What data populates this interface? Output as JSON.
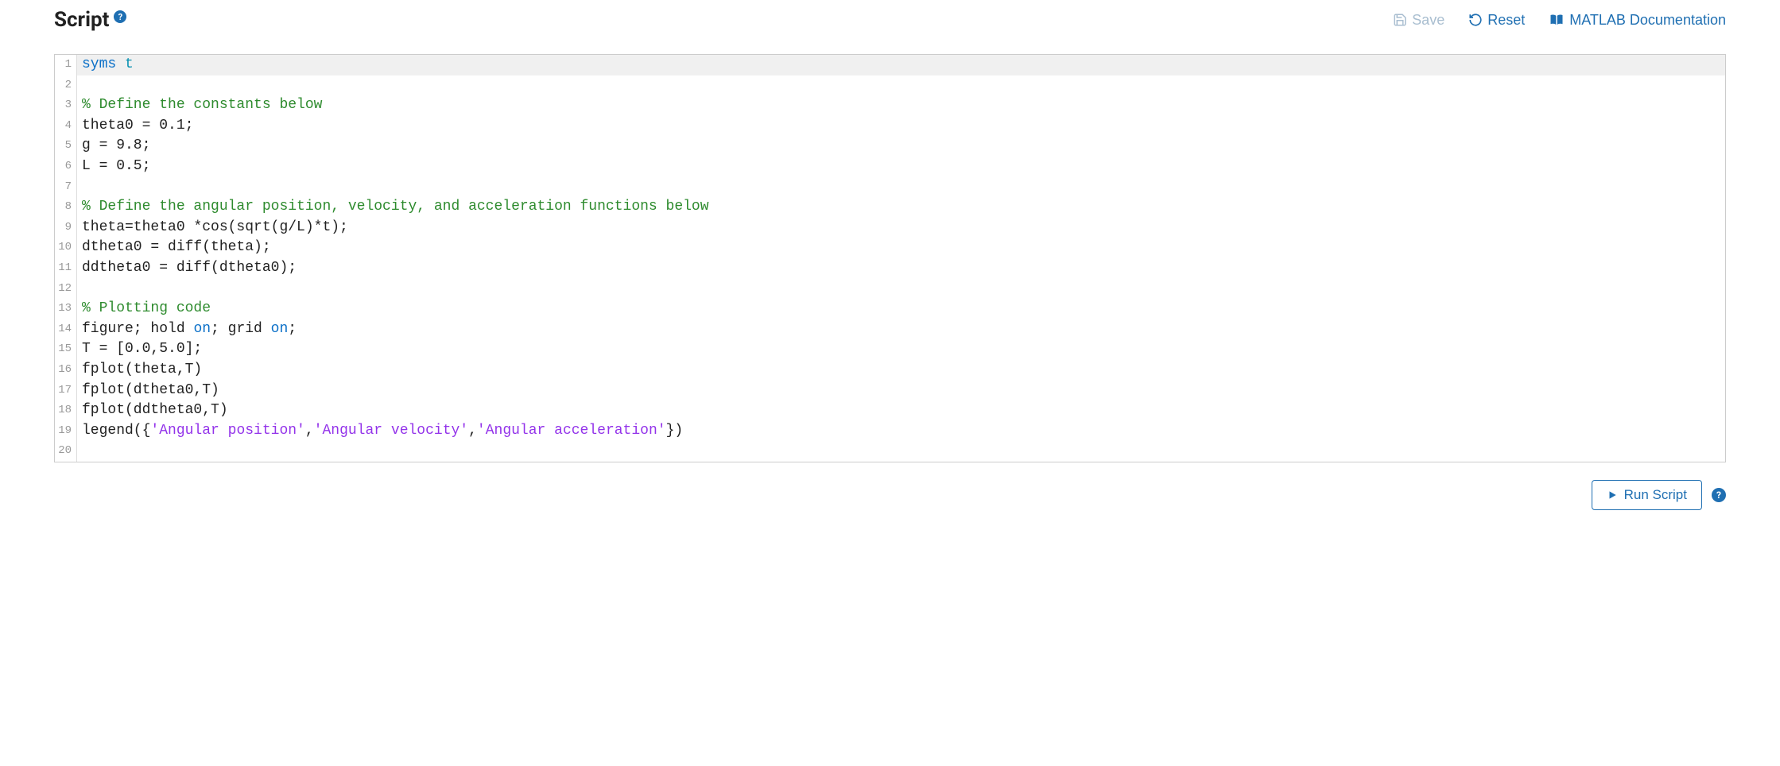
{
  "header": {
    "title": "Script",
    "help_glyph": "?"
  },
  "toolbar": {
    "save_label": "Save",
    "reset_label": "Reset",
    "docs_label": "MATLAB Documentation"
  },
  "editor": {
    "lines": [
      {
        "n": 1,
        "active": true,
        "tokens": [
          {
            "t": "syms ",
            "c": "keyword"
          },
          {
            "t": "t",
            "c": "ident"
          }
        ]
      },
      {
        "n": 2,
        "tokens": [
          {
            "t": "",
            "c": ""
          }
        ]
      },
      {
        "n": 3,
        "tokens": [
          {
            "t": "% Define the constants below",
            "c": "comment"
          }
        ]
      },
      {
        "n": 4,
        "tokens": [
          {
            "t": "theta0 = 0.1;",
            "c": ""
          }
        ]
      },
      {
        "n": 5,
        "tokens": [
          {
            "t": "g = 9.8;",
            "c": ""
          }
        ]
      },
      {
        "n": 6,
        "tokens": [
          {
            "t": "L = 0.5;",
            "c": ""
          }
        ]
      },
      {
        "n": 7,
        "tokens": [
          {
            "t": "",
            "c": ""
          }
        ]
      },
      {
        "n": 8,
        "tokens": [
          {
            "t": "% Define the angular position, velocity, and acceleration functions below",
            "c": "comment"
          }
        ]
      },
      {
        "n": 9,
        "tokens": [
          {
            "t": "theta=theta0 *cos(sqrt(g/L)*t);",
            "c": ""
          }
        ]
      },
      {
        "n": 10,
        "tokens": [
          {
            "t": "dtheta0 = diff(theta);",
            "c": ""
          }
        ]
      },
      {
        "n": 11,
        "tokens": [
          {
            "t": "ddtheta0 = diff(dtheta0);",
            "c": ""
          }
        ]
      },
      {
        "n": 12,
        "tokens": [
          {
            "t": "",
            "c": ""
          }
        ]
      },
      {
        "n": 13,
        "tokens": [
          {
            "t": "% Plotting code",
            "c": "comment"
          }
        ]
      },
      {
        "n": 14,
        "tokens": [
          {
            "t": "figure; hold ",
            "c": ""
          },
          {
            "t": "on",
            "c": "keyword"
          },
          {
            "t": "; grid ",
            "c": ""
          },
          {
            "t": "on",
            "c": "keyword"
          },
          {
            "t": ";",
            "c": ""
          }
        ]
      },
      {
        "n": 15,
        "tokens": [
          {
            "t": "T = [0.0,5.0];",
            "c": ""
          }
        ]
      },
      {
        "n": 16,
        "tokens": [
          {
            "t": "fplot(theta,T)",
            "c": ""
          }
        ]
      },
      {
        "n": 17,
        "tokens": [
          {
            "t": "fplot(dtheta0,T)",
            "c": ""
          }
        ]
      },
      {
        "n": 18,
        "tokens": [
          {
            "t": "fplot(ddtheta0,T)",
            "c": ""
          }
        ]
      },
      {
        "n": 19,
        "tokens": [
          {
            "t": "legend({",
            "c": ""
          },
          {
            "t": "'Angular position'",
            "c": "string"
          },
          {
            "t": ",",
            "c": ""
          },
          {
            "t": "'Angular velocity'",
            "c": "string"
          },
          {
            "t": ",",
            "c": ""
          },
          {
            "t": "'Angular acceleration'",
            "c": "string"
          },
          {
            "t": "})",
            "c": ""
          }
        ]
      },
      {
        "n": 20,
        "tokens": [
          {
            "t": "",
            "c": ""
          }
        ]
      }
    ]
  },
  "footer": {
    "run_label": "Run Script",
    "help_glyph": "?"
  }
}
